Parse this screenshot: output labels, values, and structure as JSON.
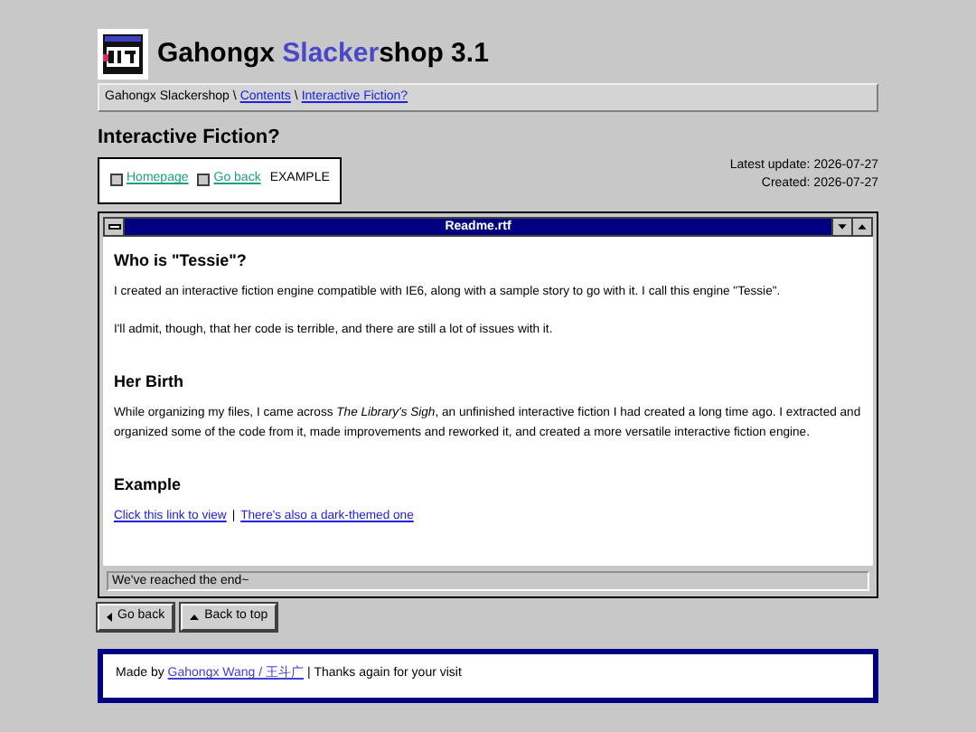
{
  "header": {
    "title_start": "Gahongx",
    "title_highlight": "Slacker",
    "title_end": "shop 3.1"
  },
  "breadcrumb": [
    {
      "label": "Gahongx Slackershop",
      "link": false
    },
    {
      "label": "Contents",
      "link": true
    },
    {
      "label": "Interactive Fiction?",
      "link": true
    }
  ],
  "breadcrumb_separator": "\\",
  "page_title": "Interactive Fiction?",
  "nav": [
    {
      "kind": "link",
      "label": "Homepage"
    },
    {
      "kind": "link",
      "label": "Go back"
    },
    {
      "kind": "text",
      "label": "EXAMPLE"
    }
  ],
  "dates": [
    "Latest update: 2026-07-27",
    "Created: 2026-07-27"
  ],
  "window": {
    "title": "Readme.rtf",
    "status": "We've reached the end~"
  },
  "blocks": [
    {
      "kind": "heading",
      "text": "Who is \"Tessie\"?"
    },
    {
      "kind": "paragraph",
      "text": "I created an interactive fiction engine compatible with IE6, along with a sample story to go with it. I call this engine \"Tessie\"."
    },
    {
      "kind": "paragraph",
      "text": "I'll admit, though, that her code is terrible, and there are still a lot of issues with it."
    },
    {
      "kind": "heading",
      "text": "Her Birth"
    },
    {
      "kind": "paragraph",
      "text": "While organizing my files, I came across *The Library's Sigh*, an unfinished interactive fiction I had created a long time ago. I extracted and organized some of the code from it, made improvements and reworked it, and created a more versatile interactive fiction engine."
    },
    {
      "kind": "heading",
      "text": "Example"
    },
    {
      "kind": "links",
      "separator": "|",
      "items": [
        "Click this link to view",
        "There's also a dark-themed one"
      ]
    }
  ],
  "buttons": [
    {
      "kind": "back",
      "label": "Go back"
    },
    {
      "kind": "top",
      "label": "Back to top"
    }
  ],
  "footer": {
    "prefix": "Made by",
    "link": "Gahongx Wang / 王斗广",
    "suffix": "| Thanks again for your visit"
  }
}
